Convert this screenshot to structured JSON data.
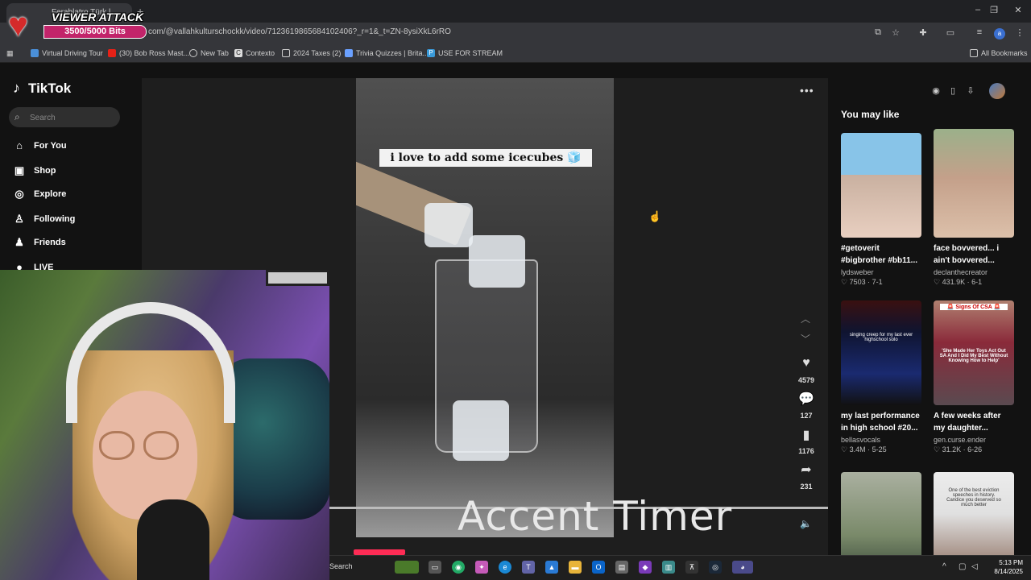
{
  "browser": {
    "tab_title": "Ferablatro Türk l...",
    "new_tab_symbol": "+",
    "window_controls": [
      "–",
      "❐",
      "✕"
    ],
    "url": "com/@vallahkulturschockk/video/7123619865684102406?_r=1&_t=ZN-8ysiXkL6rRO",
    "profile_initial": "a",
    "bookmarks": [
      {
        "label": "Virtual Driving Tour",
        "icon": "globe-icon",
        "color": "#4a8fd8"
      },
      {
        "label": "(30) Bob Ross Mast...",
        "icon": "youtube-icon",
        "color": "#e62117"
      },
      {
        "label": "New Tab",
        "icon": "chrome-icon",
        "color": "#ccc"
      },
      {
        "label": "Contexto",
        "icon": "c-icon",
        "color": "#ddd"
      },
      {
        "label": "2024 Taxes (2)",
        "icon": "folder-icon",
        "color": "#ccc"
      },
      {
        "label": "Trivia Quizzes | Brita...",
        "icon": "trivia-icon",
        "color": "#6aa0ff"
      },
      {
        "label": "USE FOR STREAM",
        "icon": "p-icon",
        "color": "#3a9ad9"
      }
    ],
    "all_bookmarks": "All Bookmarks"
  },
  "overlay": {
    "title": "VIEWER ATTACK",
    "bits": "3500/5000 Bits",
    "bits_progress": 0.7
  },
  "tiktok": {
    "logo": "TikTok",
    "search_placeholder": "Search",
    "nav": [
      {
        "label": "For You",
        "icon": "home-icon",
        "glyph": "⌂"
      },
      {
        "label": "Shop",
        "icon": "shop-icon",
        "glyph": "🛍"
      },
      {
        "label": "Explore",
        "icon": "compass-icon",
        "glyph": "◎"
      },
      {
        "label": "Following",
        "icon": "following-icon",
        "glyph": "👤"
      },
      {
        "label": "Friends",
        "icon": "friends-icon",
        "glyph": "👥"
      },
      {
        "label": "LIVE",
        "icon": "live-icon",
        "glyph": "●"
      }
    ],
    "video": {
      "caption": "i love to add some icecubes 🧊",
      "likes": "4579",
      "comments": "127",
      "saves": "1176",
      "shares": "231"
    },
    "you_may_like": "You may like",
    "cards": [
      {
        "title": "#getoverit #bigbrother #bb11...",
        "author": "lydsweber",
        "stats": "♡ 7503 · 7-1"
      },
      {
        "title": "face bovvered... i ain't bovvered...",
        "author": "declanthecreator",
        "stats": "♡ 431.9K · 6-1"
      },
      {
        "title": "my last performance in high school #20...",
        "author": "bellasvocals",
        "stats": "♡ 3.4M · 5-25",
        "thumb_text": "singing creep for my last ever highschool solo"
      },
      {
        "title": "A few weeks after my daughter...",
        "author": "gen.curse.ender",
        "stats": "♡ 31.2K · 6-26",
        "thumb_text": "🚨 Signs Of CSA 🚨",
        "thumb_text2": "'She Made Her Toys Act Out SA And I Did My Best Without Knowing How to Help'"
      },
      {
        "title": "",
        "author": "",
        "stats": ""
      },
      {
        "title": "",
        "author": "",
        "stats": "",
        "thumb_text": "One of the best eviction speeches in history. Candice you deserved so much better"
      }
    ]
  },
  "stream": {
    "accent_timer": "Accent Timer"
  },
  "taskbar": {
    "search": "Search",
    "time": "5:13 PM",
    "date": "8/14/2025"
  }
}
